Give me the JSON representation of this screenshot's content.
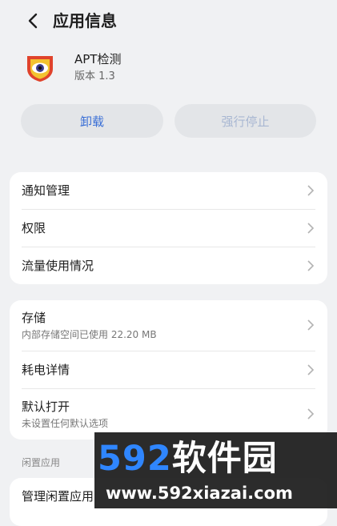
{
  "header": {
    "title": "应用信息"
  },
  "app": {
    "name": "APT检测",
    "version": "版本 1.3"
  },
  "actions": {
    "uninstall": "卸载",
    "force_stop": "强行停止"
  },
  "group1": [
    {
      "title": "通知管理"
    },
    {
      "title": "权限"
    },
    {
      "title": "流量使用情况"
    }
  ],
  "group2": [
    {
      "title": "存储",
      "subtitle": "内部存储空间已使用 22.20 MB"
    },
    {
      "title": "耗电详情"
    },
    {
      "title": "默认打开",
      "subtitle": "未设置任何默认选项"
    }
  ],
  "section": {
    "label": "闲置应用"
  },
  "group3": [
    {
      "title": "管理闲置应用"
    }
  ],
  "watermark": {
    "brand_num": "592",
    "brand_cn": "软件园",
    "url": "www.592xiazai.com"
  },
  "colors": {
    "accent": "#3a6fd6",
    "disabled": "#a8b7d2",
    "background": "#f0f1f3"
  }
}
